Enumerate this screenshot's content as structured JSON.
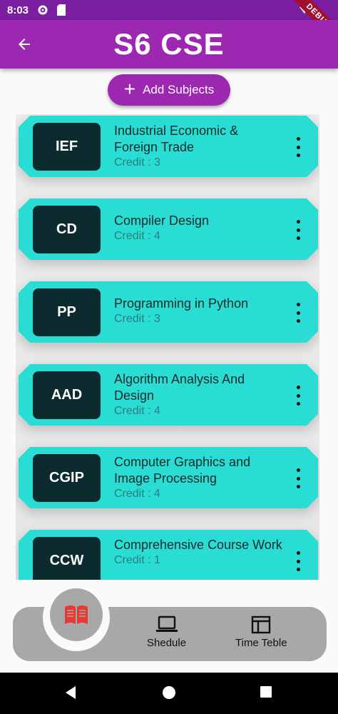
{
  "status_bar": {
    "time": "8:03",
    "debug_label": "DEBUG"
  },
  "app_bar": {
    "title": "S6 CSE"
  },
  "add_button": {
    "label": "Add Subjects"
  },
  "subjects": [
    {
      "code": "IEF",
      "name": "Industrial Economic & Foreign Trade",
      "credit": "Credit : 3"
    },
    {
      "code": "CD",
      "name": "Compiler Design",
      "credit": "Credit : 4"
    },
    {
      "code": "PP",
      "name": "Programming in Python",
      "credit": "Credit : 3"
    },
    {
      "code": "AAD",
      "name": "Algorithm Analysis And Design",
      "credit": "Credit : 4"
    },
    {
      "code": "CGIP",
      "name": "Computer Graphics and Image Processing",
      "credit": "Credit : 4"
    },
    {
      "code": "CCW",
      "name": "Comprehensive Course Work",
      "credit": "Credit : 1"
    }
  ],
  "bottom_nav": {
    "fab_icon": "book-icon",
    "items": [
      {
        "label": "Shedule",
        "icon": "laptop-icon"
      },
      {
        "label": "Time Teble",
        "icon": "table-icon"
      }
    ]
  },
  "colors": {
    "app_bar": "#9c27b0",
    "card": "#29dcd4",
    "code_box": "#0c2b2e",
    "fab_icon": "#e53935"
  }
}
